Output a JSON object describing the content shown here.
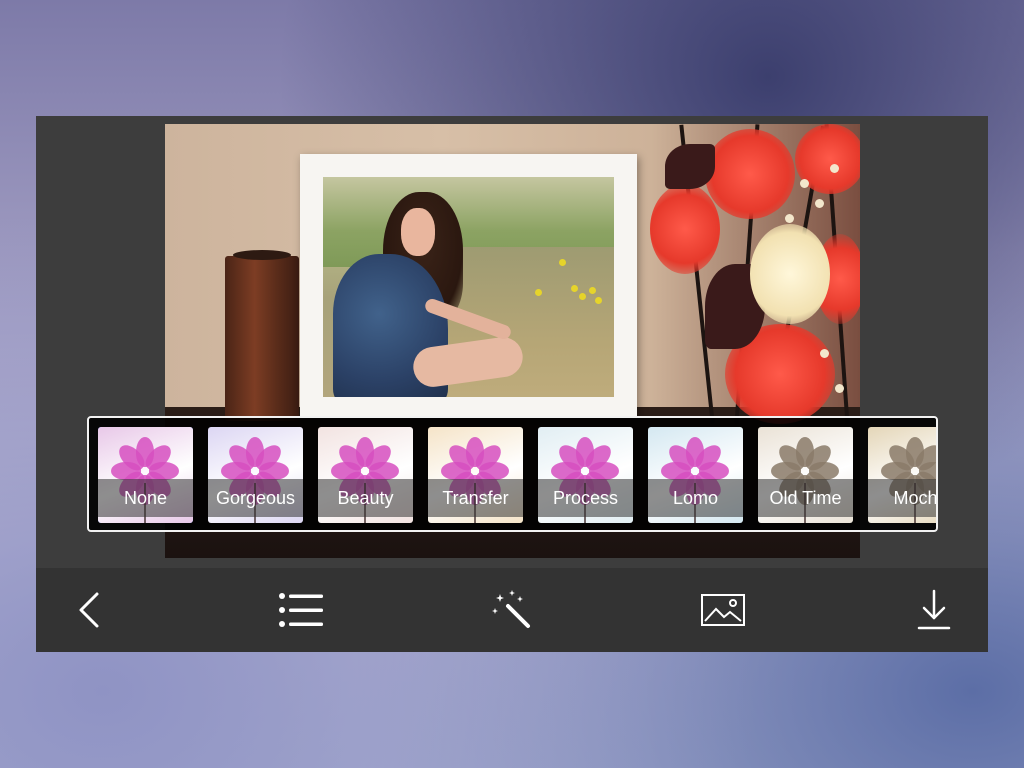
{
  "filters": {
    "items": [
      {
        "label": "None",
        "selected": true,
        "tint": "#e8c8e8"
      },
      {
        "label": "Gorgeous",
        "selected": false,
        "tint": "#dcd6f3"
      },
      {
        "label": "Beauty",
        "selected": false,
        "tint": "#f2e3e1"
      },
      {
        "label": "Transfer",
        "selected": false,
        "tint": "#f5e4c8"
      },
      {
        "label": "Process",
        "selected": false,
        "tint": "#e1eef3"
      },
      {
        "label": "Lomo",
        "selected": false,
        "tint": "#d4e8f1"
      },
      {
        "label": "Old Time",
        "selected": false,
        "tint": "#eae2d6"
      },
      {
        "label": "Moch",
        "selected": false,
        "tint": "#e4d6b8"
      }
    ]
  },
  "toolbar": {
    "back_icon": "chevron-left-icon",
    "list_icon": "list-icon",
    "effects_icon": "magic-wand-icon",
    "gallery_icon": "image-icon",
    "download_icon": "download-icon"
  },
  "colors": {
    "selected_outline": "#1a73ff",
    "toolbar_bg": "#333333",
    "panel_bg": "#3d3d3d"
  }
}
